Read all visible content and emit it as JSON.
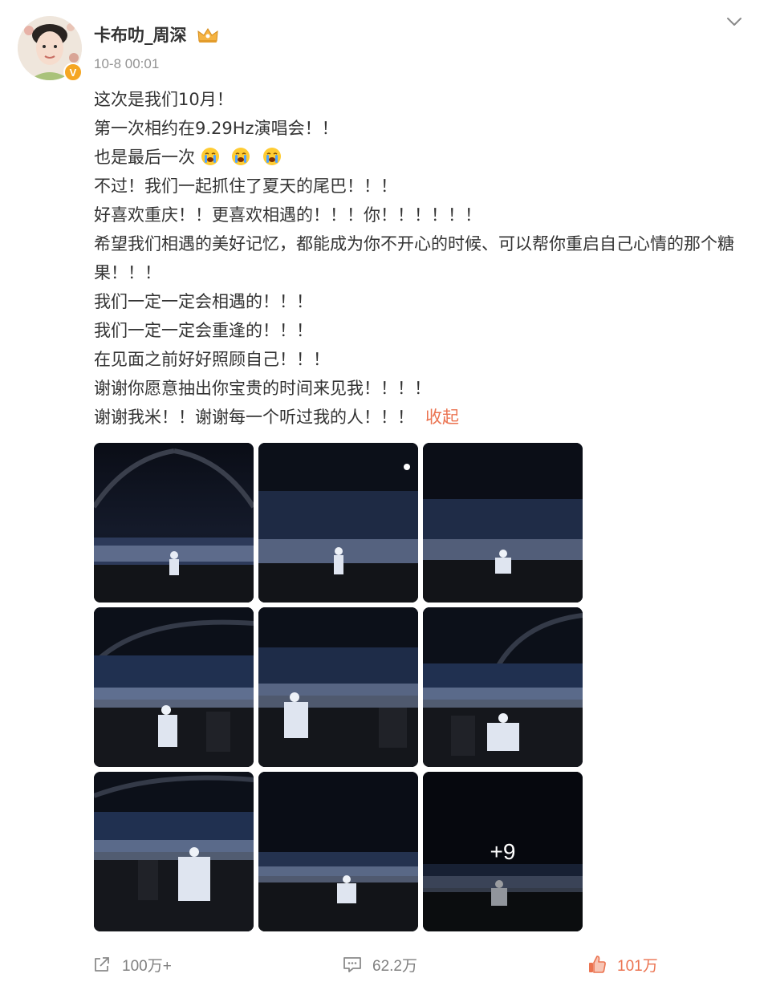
{
  "user": {
    "name": "卡布叻_周深",
    "timestamp": "10-8 00:01",
    "verified_badge": "V",
    "crown_icon": "crown-icon"
  },
  "post": {
    "lines": [
      "这次是我们10月！",
      "第一次相约在9.29Hz演唱会！！",
      "也是最后一次",
      "不过！我们一起抓住了夏天的尾巴！！！",
      "好喜欢重庆！！更喜欢相遇的！！！你！！！！！！",
      "希望我们相遇的美好记忆，都能成为你不开心的时候、可以帮你重启自己心情的那个糖果！！！",
      "我们一定一定会相遇的！！！",
      "我们一定一定会重逢的！！！",
      "在见面之前好好照顾自己！！！",
      "谢谢你愿意抽出你宝贵的时间来见我！！！！",
      "谢谢我米！！谢谢每一个听过我的人！！！"
    ],
    "collapse_label": "收起",
    "emoji_icon": "crying-face-icon"
  },
  "images": {
    "more_count_label": "+9"
  },
  "actions": {
    "share_count": "100万+",
    "comment_count": "62.2万",
    "like_count": "101万"
  },
  "colors": {
    "accent": "#eb7350",
    "muted": "#939393",
    "text": "#333333",
    "badge": "#f5a623"
  }
}
